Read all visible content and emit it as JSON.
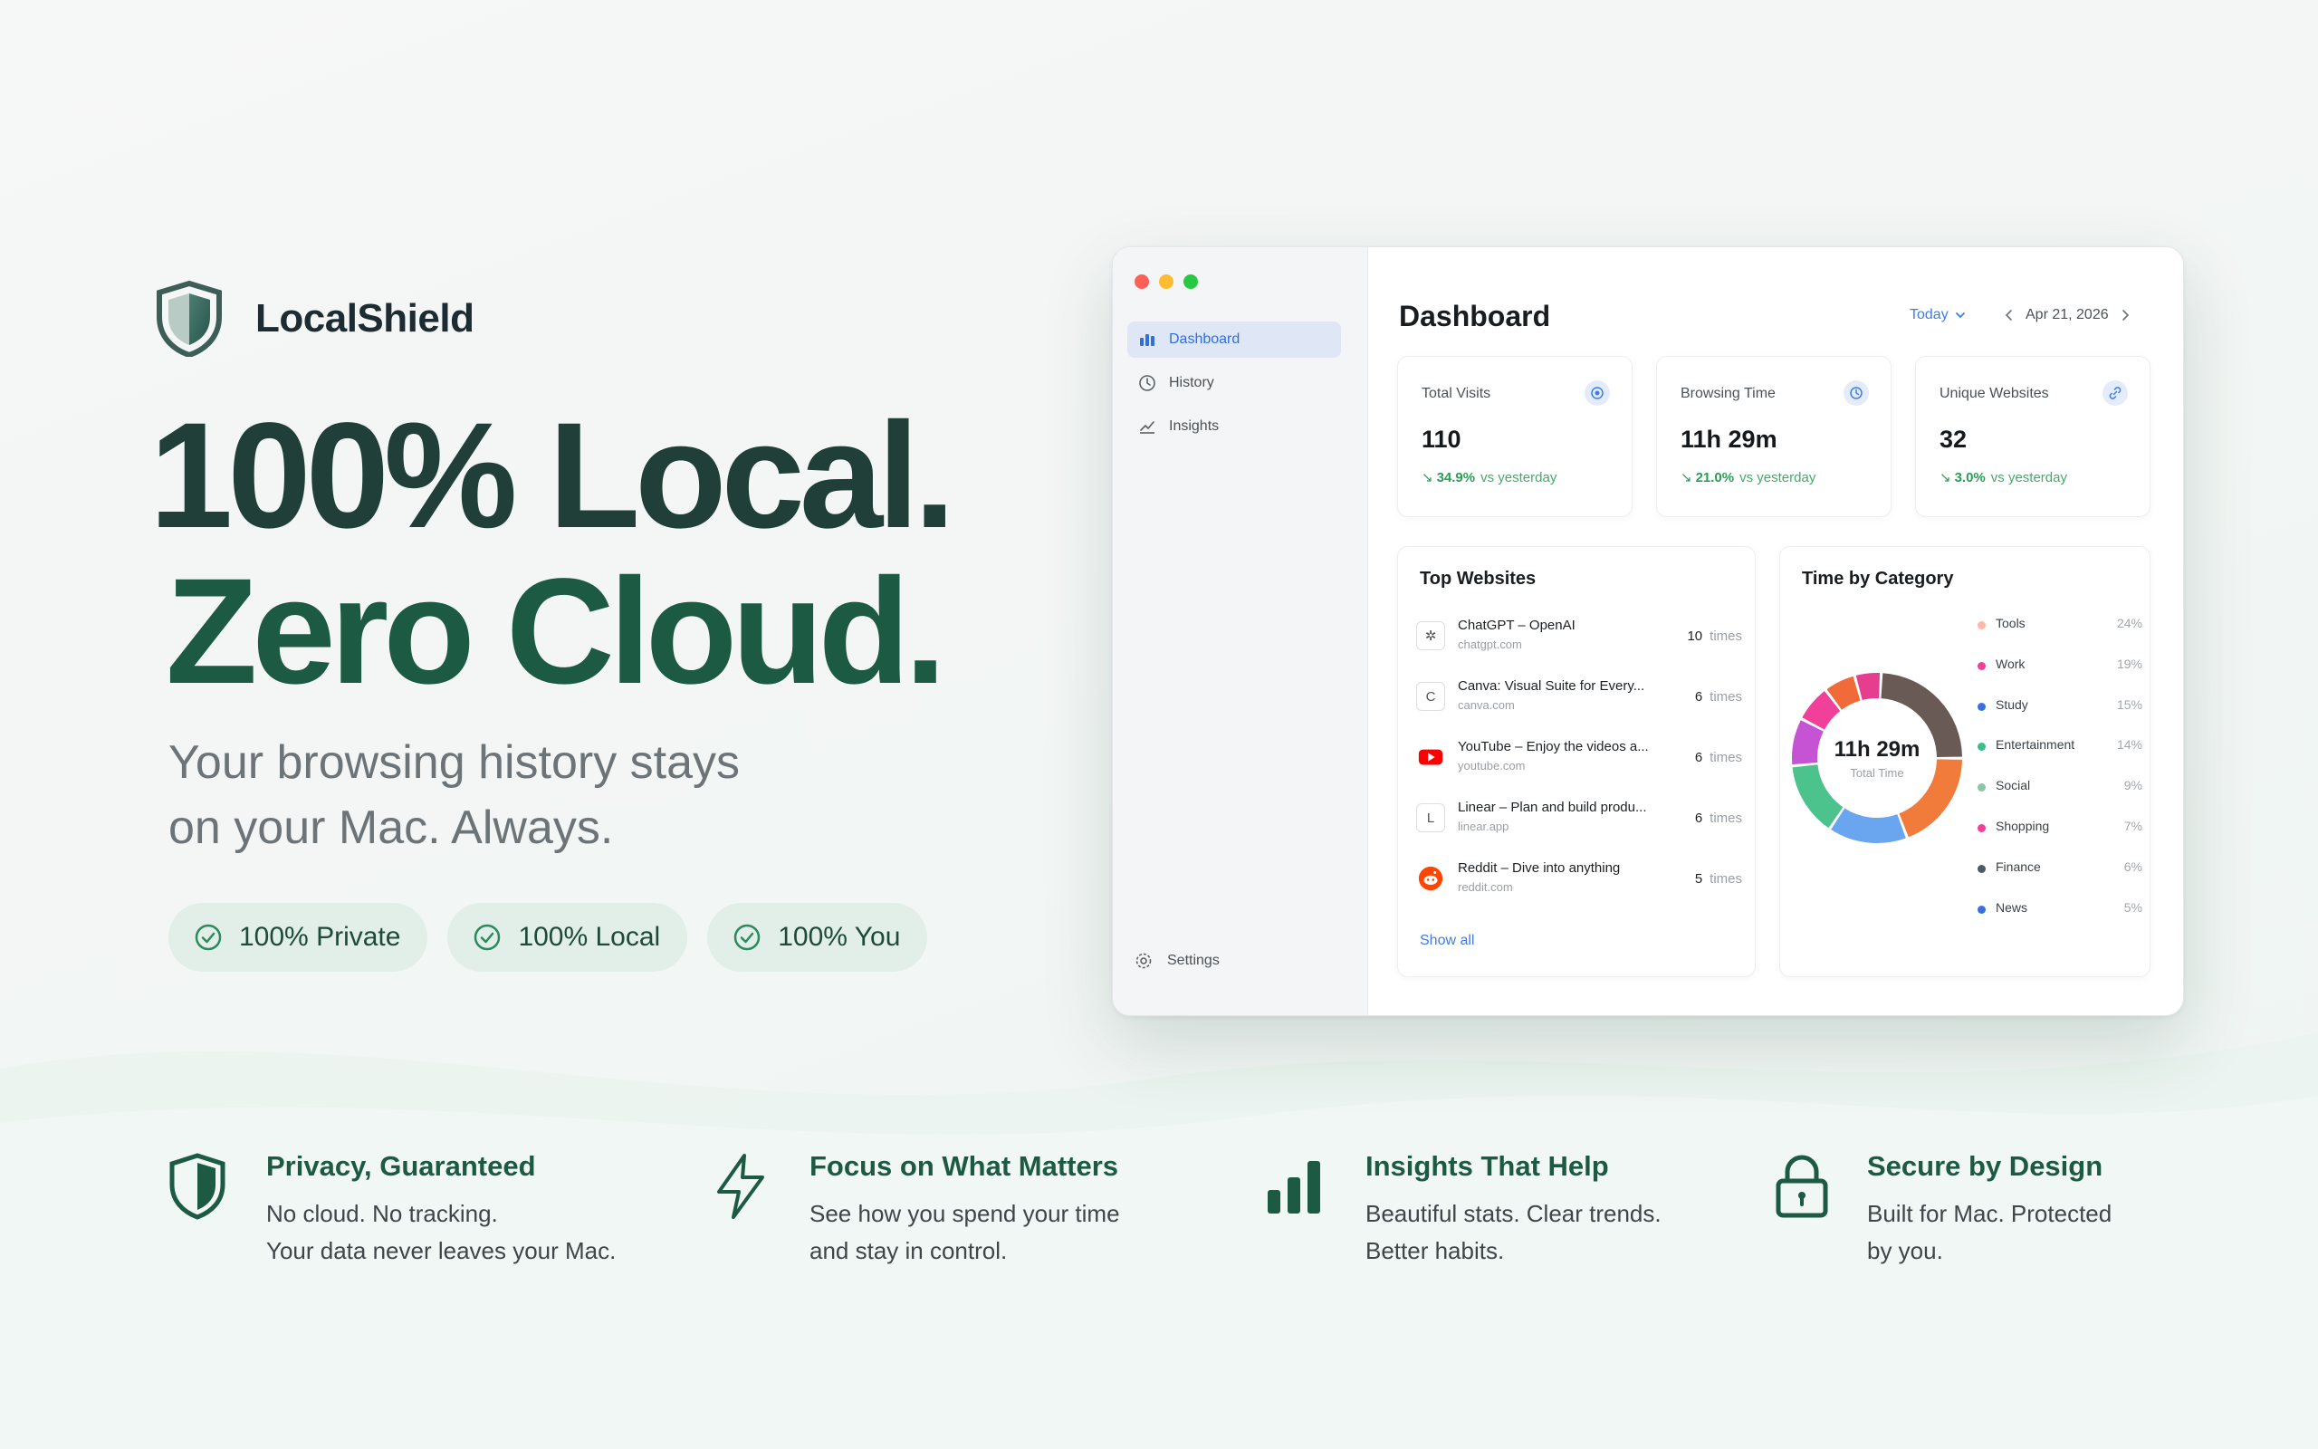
{
  "brand": {
    "name": "LocalShield"
  },
  "hero": {
    "headline_line1": "100% Local.",
    "headline_line2": "Zero Cloud.",
    "subtitle_line1": "Your browsing history stays",
    "subtitle_line2": "on your Mac. Always.",
    "pills": [
      "100% Private",
      "100% Local",
      "100% You"
    ]
  },
  "app": {
    "sidebar": {
      "items": [
        {
          "label": "Dashboard",
          "icon": "bar-chart-icon",
          "active": true
        },
        {
          "label": "History",
          "icon": "clock-icon",
          "active": false
        },
        {
          "label": "Insights",
          "icon": "line-chart-icon",
          "active": false
        }
      ],
      "settings_label": "Settings"
    },
    "header": {
      "title": "Dashboard",
      "range": "Today",
      "date": "Apr 21, 2026"
    },
    "stats": [
      {
        "label": "Total Visits",
        "value": "110",
        "change": "34.9%",
        "vs": "vs yesterday",
        "icon": "target-icon"
      },
      {
        "label": "Browsing Time",
        "value": "11h 29m",
        "change": "21.0%",
        "vs": "vs yesterday",
        "icon": "clock-icon"
      },
      {
        "label": "Unique Websites",
        "value": "32",
        "change": "3.0%",
        "vs": "vs yesterday",
        "icon": "link-icon"
      }
    ],
    "top_websites": {
      "title": "Top Websites",
      "times_label": "times",
      "rows": [
        {
          "name": "ChatGPT – OpenAI",
          "domain": "chatgpt.com",
          "count": "10",
          "icon": "openai-icon"
        },
        {
          "name": "Canva: Visual Suite for Every...",
          "domain": "canva.com",
          "count": "6",
          "icon": "c-letter-icon"
        },
        {
          "name": "YouTube – Enjoy the videos a...",
          "domain": "youtube.com",
          "count": "6",
          "icon": "youtube-icon"
        },
        {
          "name": "Linear – Plan and build produ...",
          "domain": "linear.app",
          "count": "6",
          "icon": "l-letter-icon"
        },
        {
          "name": "Reddit – Dive into anything",
          "domain": "reddit.com",
          "count": "5",
          "icon": "reddit-icon"
        }
      ],
      "show_all": "Show all"
    },
    "category": {
      "title": "Time by Category",
      "total_time": "11h 29m",
      "total_label": "Total Time",
      "items": [
        {
          "name": "Tools",
          "pct": "24%",
          "value": 24,
          "color": "#ffb8a8",
          "ring_color": "#6a5a55"
        },
        {
          "name": "Work",
          "pct": "19%",
          "value": 19,
          "color": "#f0409a",
          "ring_color": "#f07b3a"
        },
        {
          "name": "Study",
          "pct": "15%",
          "value": 15,
          "color": "#3a6fe0",
          "ring_color": "#6aa6f0"
        },
        {
          "name": "Entertainment",
          "pct": "14%",
          "value": 14,
          "color": "#3dbd8a",
          "ring_color": "#4cc28d"
        },
        {
          "name": "Social",
          "pct": "9%",
          "value": 9,
          "color": "#8bc7a4",
          "ring_color": "#c653d4"
        },
        {
          "name": "Shopping",
          "pct": "7%",
          "value": 7,
          "color": "#f0409a",
          "ring_color": "#f0409a"
        },
        {
          "name": "Finance",
          "pct": "6%",
          "value": 6,
          "color": "#4e5a60",
          "ring_color": "#f06a3a"
        },
        {
          "name": "News",
          "pct": "5%",
          "value": 5,
          "color": "#3a6fe0",
          "ring_color": "#e63e8f"
        }
      ]
    }
  },
  "features": [
    {
      "title": "Privacy, Guaranteed",
      "line1": "No cloud. No tracking.",
      "line2": "Your data never leaves your Mac.",
      "icon": "shield-icon"
    },
    {
      "title": "Focus on What Matters",
      "line1": "See how you spend your time",
      "line2": "and stay in control.",
      "icon": "lightning-icon"
    },
    {
      "title": "Insights That Help",
      "line1": "Beautiful stats. Clear trends.",
      "line2": "Better habits.",
      "icon": "bar-chart-icon"
    },
    {
      "title": "Secure by Design",
      "line1": "Built for Mac. Protected",
      "line2": "by you.",
      "icon": "lock-icon"
    }
  ],
  "colors": {
    "brand_green": "#1d5a44",
    "accent_blue": "#3f7de6",
    "positive_green": "#2a9d55"
  }
}
